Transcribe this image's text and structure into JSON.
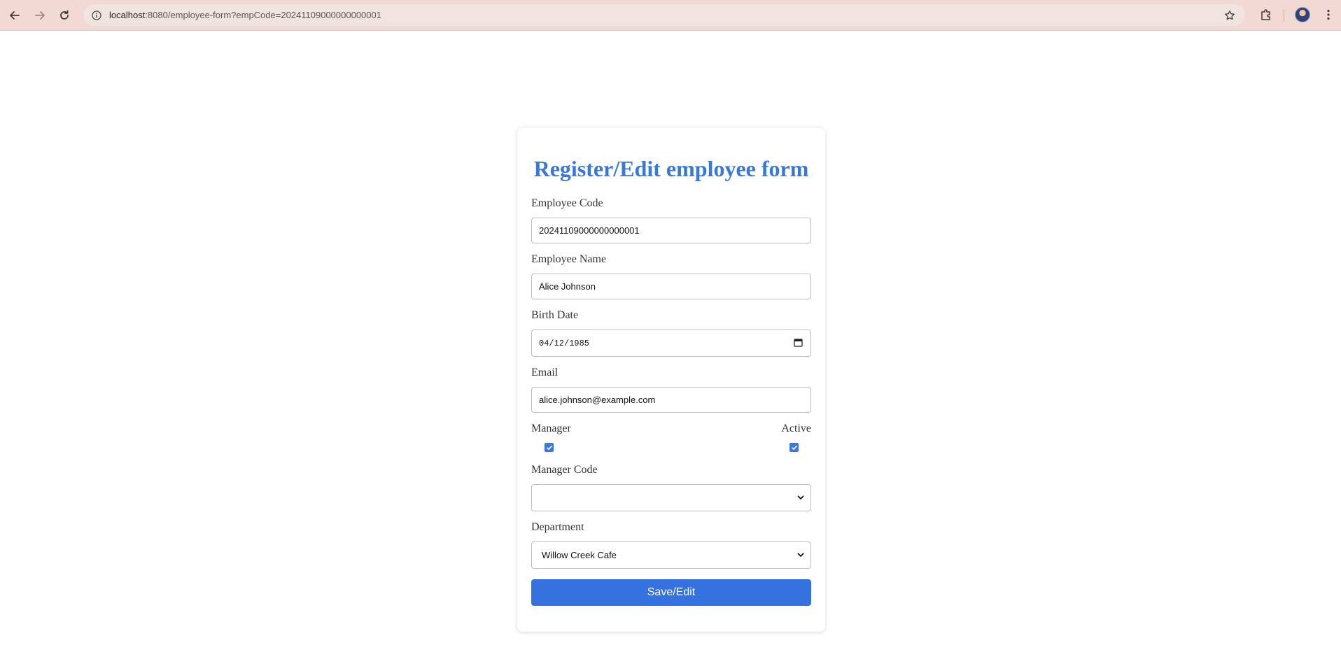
{
  "browser": {
    "url_host": "localhost",
    "url_rest": ":8080/employee-form?empCode=20241109000000000001"
  },
  "form": {
    "title": "Register/Edit employee form",
    "employee_code_label": "Employee Code",
    "employee_code_value": "20241109000000000001",
    "employee_name_label": "Employee Name",
    "employee_name_value": "Alice Johnson",
    "birth_date_label": "Birth Date",
    "birth_date_value": "04/12/1985",
    "email_label": "Email",
    "email_value": "alice.johnson@example.com",
    "manager_label": "Manager",
    "manager_checked": true,
    "active_label": "Active",
    "active_checked": true,
    "manager_code_label": "Manager Code",
    "manager_code_value": "",
    "department_label": "Department",
    "department_value": "Willow Creek Cafe",
    "save_label": "Save/Edit"
  },
  "colors": {
    "accent": "#3a78d8",
    "button": "#3671e0",
    "chrome": "#f2d9d3"
  }
}
